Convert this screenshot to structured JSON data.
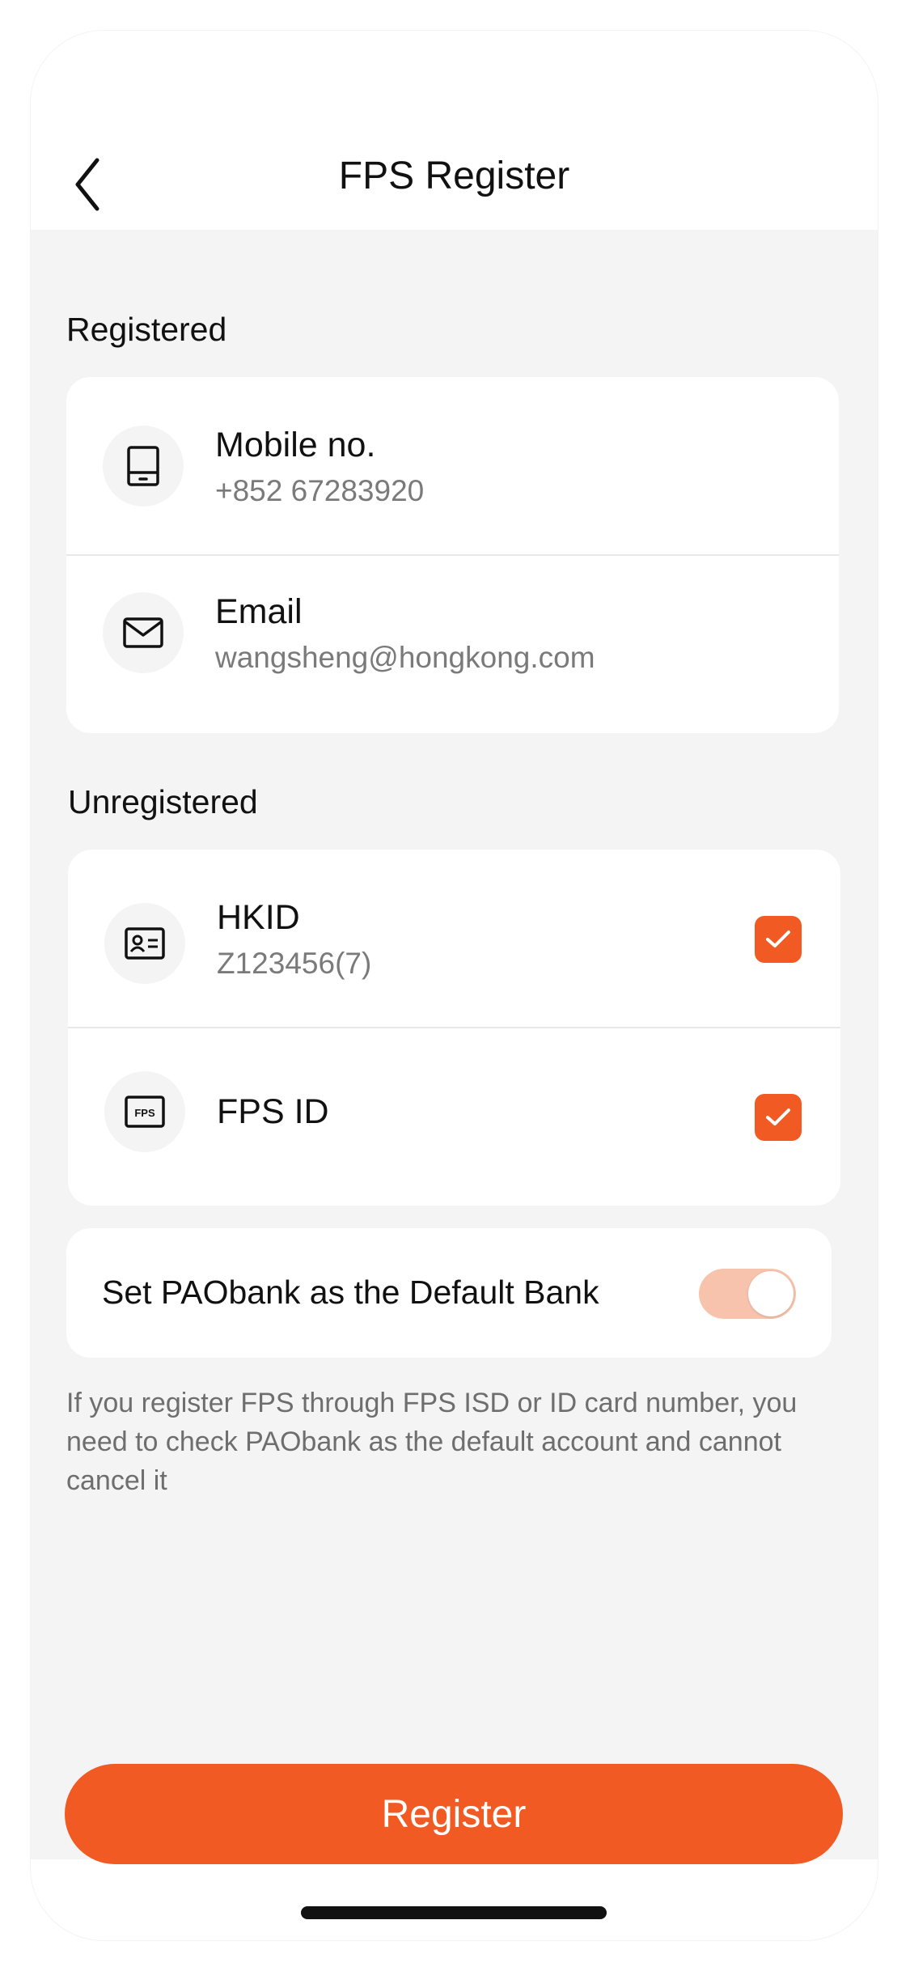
{
  "header": {
    "title": "FPS Register",
    "back_icon": "chevron-left-icon"
  },
  "registered": {
    "section_title": "Registered",
    "items": [
      {
        "icon": "mobile-icon",
        "title": "Mobile no.",
        "value": "+852 67283920"
      },
      {
        "icon": "mail-icon",
        "title": "Email",
        "value": "wangsheng@hongkong.com"
      }
    ]
  },
  "unregistered": {
    "section_title": "Unregistered",
    "items": [
      {
        "icon": "id-card-icon",
        "title": "HKID",
        "value": "Z123456(7)",
        "checked": true
      },
      {
        "icon": "fps-icon",
        "title": "FPS ID",
        "icon_text": "FPS",
        "checked": true
      }
    ]
  },
  "default_bank": {
    "label": "Set PAObank as the Default Bank",
    "enabled": true
  },
  "note": "If you register FPS through FPS ISD or ID card number, you need to check PAObank as the default account and cannot cancel it",
  "actions": {
    "register_label": "Register"
  },
  "colors": {
    "accent": "#f15a22",
    "toggle_track": "#f8c3ad",
    "background": "#f4f4f4"
  }
}
